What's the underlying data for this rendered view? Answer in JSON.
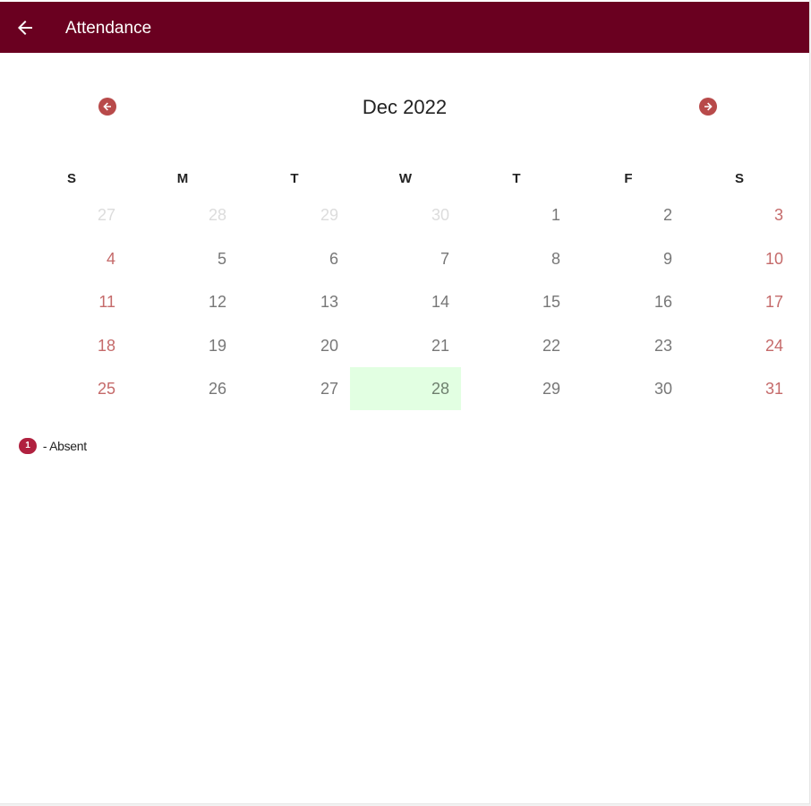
{
  "header": {
    "title": "Attendance"
  },
  "calendar": {
    "month_label": "Dec 2022",
    "weekdays": [
      "S",
      "M",
      "T",
      "W",
      "T",
      "F",
      "S"
    ],
    "weeks": [
      [
        {
          "day": "27",
          "state": "other"
        },
        {
          "day": "28",
          "state": "other"
        },
        {
          "day": "29",
          "state": "other"
        },
        {
          "day": "30",
          "state": "other"
        },
        {
          "day": "1",
          "state": "normal"
        },
        {
          "day": "2",
          "state": "normal"
        },
        {
          "day": "3",
          "state": "weekend"
        }
      ],
      [
        {
          "day": "4",
          "state": "weekend"
        },
        {
          "day": "5",
          "state": "normal"
        },
        {
          "day": "6",
          "state": "normal"
        },
        {
          "day": "7",
          "state": "normal"
        },
        {
          "day": "8",
          "state": "normal"
        },
        {
          "day": "9",
          "state": "normal"
        },
        {
          "day": "10",
          "state": "weekend"
        }
      ],
      [
        {
          "day": "11",
          "state": "weekend"
        },
        {
          "day": "12",
          "state": "normal"
        },
        {
          "day": "13",
          "state": "normal"
        },
        {
          "day": "14",
          "state": "normal"
        },
        {
          "day": "15",
          "state": "normal"
        },
        {
          "day": "16",
          "state": "normal"
        },
        {
          "day": "17",
          "state": "weekend"
        }
      ],
      [
        {
          "day": "18",
          "state": "weekend"
        },
        {
          "day": "19",
          "state": "normal"
        },
        {
          "day": "20",
          "state": "normal"
        },
        {
          "day": "21",
          "state": "normal"
        },
        {
          "day": "22",
          "state": "normal"
        },
        {
          "day": "23",
          "state": "normal"
        },
        {
          "day": "24",
          "state": "weekend"
        }
      ],
      [
        {
          "day": "25",
          "state": "weekend"
        },
        {
          "day": "26",
          "state": "normal"
        },
        {
          "day": "27",
          "state": "normal"
        },
        {
          "day": "28",
          "state": "today"
        },
        {
          "day": "29",
          "state": "normal"
        },
        {
          "day": "30",
          "state": "normal"
        },
        {
          "day": "31",
          "state": "weekend"
        }
      ]
    ]
  },
  "legend": {
    "badge": "1",
    "label": "- Absent"
  },
  "icons": {
    "back": "arrow-left-icon",
    "prev_month": "arrow-left-circle-icon",
    "next_month": "arrow-right-circle-icon"
  },
  "colors": {
    "header_bg": "#6a0020",
    "weekend_text": "#c56a6a",
    "today_bg": "#e2ffe2",
    "absent_badge": "#b0213f",
    "nav_button": "#b84a4a"
  }
}
